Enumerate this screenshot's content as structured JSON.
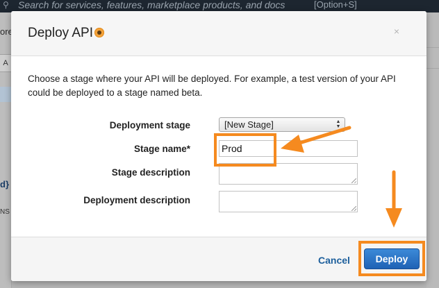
{
  "background": {
    "search_placeholder": "Search for services, features, marketplace products, and docs",
    "search_shortcut": "[Option+S]",
    "fragment_ore": "ore",
    "fragment_brace": "d}",
    "fragment_ns": "NS"
  },
  "modal": {
    "title": "Deploy API",
    "close_glyph": "×",
    "description": "Choose a stage where your API will be deployed. For example, a test version of your API could be deployed to a stage named beta.",
    "fields": {
      "deployment_stage": {
        "label": "Deployment stage",
        "value": "[New Stage]"
      },
      "stage_name": {
        "label": "Stage name*",
        "value": "Prod"
      },
      "stage_description": {
        "label": "Stage description",
        "value": ""
      },
      "deployment_description": {
        "label": "Deployment description",
        "value": ""
      }
    },
    "footer": {
      "cancel_label": "Cancel",
      "deploy_label": "Deploy"
    }
  },
  "colors": {
    "annotation": "#f58a1f",
    "primary_button": "#1f62b5",
    "link": "#1d5f9c"
  },
  "icons": {
    "info": "info-icon",
    "close": "close-icon",
    "search": "search-icon"
  }
}
